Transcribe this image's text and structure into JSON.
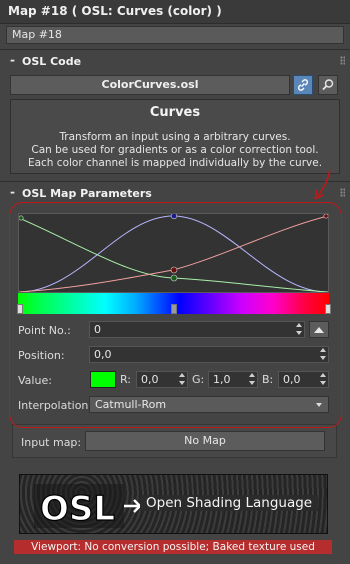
{
  "window": {
    "title": "Map #18  ( OSL: Curves (color) )"
  },
  "map_name": "Map #18",
  "osl_code": {
    "section_label": "OSL Code",
    "toggle": "-",
    "file_name": "ColorCurves.osl",
    "link_icon": "link-icon",
    "search_icon": "magnifier-icon",
    "description": {
      "title": "Curves",
      "lines": [
        "Transform an input using a arbitrary curves.",
        "Can be used for gradients or as a color correction tool.",
        "Each color channel is mapped individually by the curve."
      ]
    }
  },
  "map_params": {
    "section_label": "OSL Map Parameters",
    "toggle": "-",
    "point_no": {
      "label": "Point No.:",
      "value": "0"
    },
    "position": {
      "label": "Position:",
      "value": "0,0"
    },
    "value": {
      "label": "Value:",
      "swatch_color": "#00ff00",
      "r_label": "R:",
      "r": "0,0",
      "g_label": "G:",
      "g": "1,0",
      "b_label": "B:",
      "b": "0,0"
    },
    "interpolation": {
      "label": "Interpolation:",
      "selected": "Catmull-Rom"
    },
    "input_map": {
      "label": "Input map:",
      "button": "No Map"
    }
  },
  "banner": {
    "text": "Open Shading Language",
    "logo": "OSL"
  },
  "viewport_message": "Viewport: No conversion possible; Baked texture used",
  "colors": {
    "annotation_red": "#c01818",
    "curve_red": "#f2a0a0",
    "curve_green": "#a8f0a8",
    "curve_blue": "#b6b6ff"
  }
}
